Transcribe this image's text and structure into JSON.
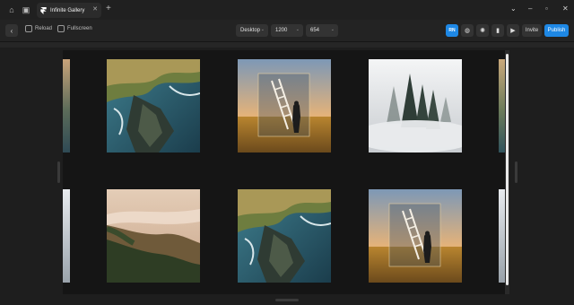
{
  "tab": {
    "title": "Infinite Gallery"
  },
  "toolbar": {
    "reload_label": "Reload",
    "fullscreen_label": "Fullscreen",
    "device": "Desktop",
    "width": "1200",
    "height": "654",
    "badge": "RN",
    "invite_label": "Invite",
    "publish_label": "Publish"
  },
  "colors": {
    "accent": "#1e88e5"
  },
  "gallery": {
    "tiles": [
      {
        "name": "coastal-cliffs-image"
      },
      {
        "name": "ladder-sunset-image"
      },
      {
        "name": "foggy-forest-image"
      },
      {
        "name": "misty-hills-image"
      },
      {
        "name": "coastal-cliffs-image"
      },
      {
        "name": "ladder-sunset-image"
      }
    ]
  }
}
